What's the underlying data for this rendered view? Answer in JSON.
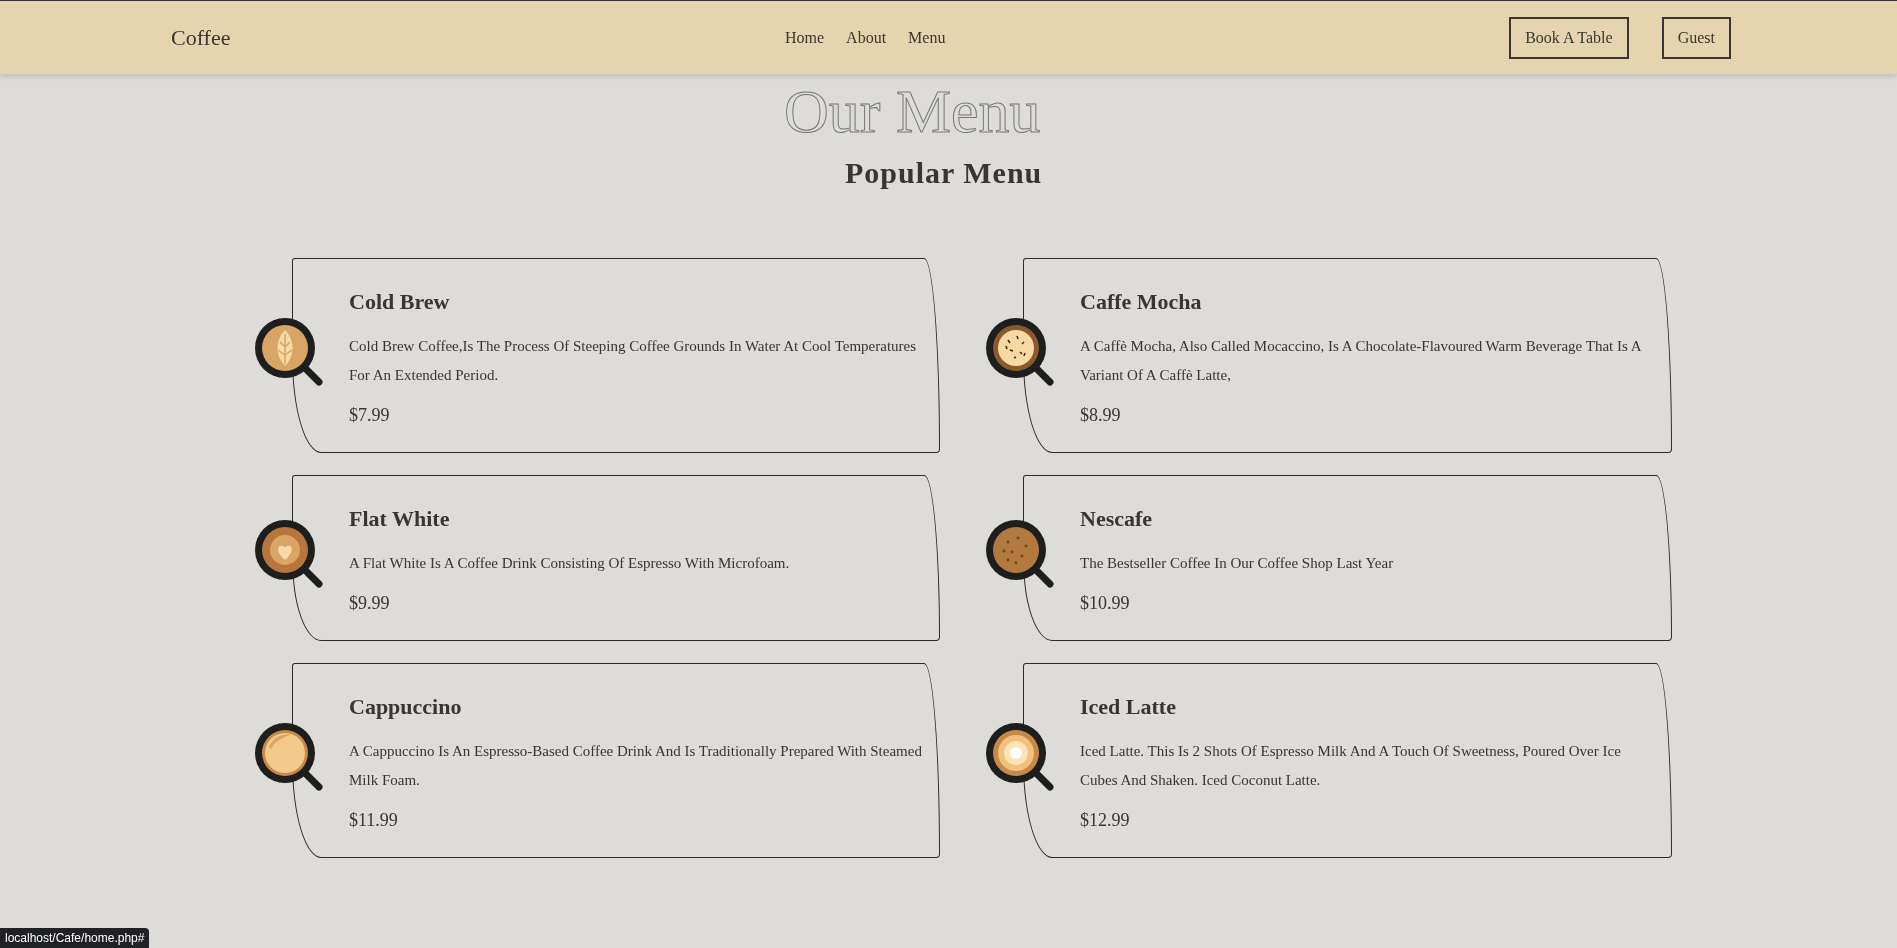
{
  "header": {
    "logo": "Coffee",
    "nav": [
      "Home",
      "About",
      "Menu"
    ],
    "buttons": [
      "Book A Table",
      "Guest"
    ]
  },
  "section": {
    "backdrop_title": "Our Menu",
    "title": "Popular Menu"
  },
  "menu_items": [
    {
      "name": "Cold Brew",
      "description": "Cold Brew Coffee,Is The Process Of Steeping Coffee Grounds In Water At Cool Temperatures For An Extended Period.",
      "price": "$7.99"
    },
    {
      "name": "Caffe Mocha",
      "description": "A Caffè Mocha, Also Called Mocaccino, Is A Chocolate-Flavoured Warm Beverage That Is A Variant Of A Caffè Latte,",
      "price": "$8.99"
    },
    {
      "name": "Flat White",
      "description": "A Flat White Is A Coffee Drink Consisting Of Espresso With Microfoam.",
      "price": "$9.99"
    },
    {
      "name": "Nescafe",
      "description": "The Bestseller Coffee In Our Coffee Shop Last Year",
      "price": "$10.99"
    },
    {
      "name": "Cappuccino",
      "description": "A Cappuccino Is An Espresso-Based Coffee Drink And Is Traditionally Prepared With Steamed Milk Foam.",
      "price": "$11.99"
    },
    {
      "name": "Iced Latte",
      "description": "Iced Latte. This Is 2 Shots Of Espresso Milk And A Touch Of Sweetness, Poured Over Ice Cubes And Shaken. Iced Coconut Latte.",
      "price": "$12.99"
    }
  ],
  "status_bar": {
    "url": "localhost/Cafe/home.php#"
  }
}
